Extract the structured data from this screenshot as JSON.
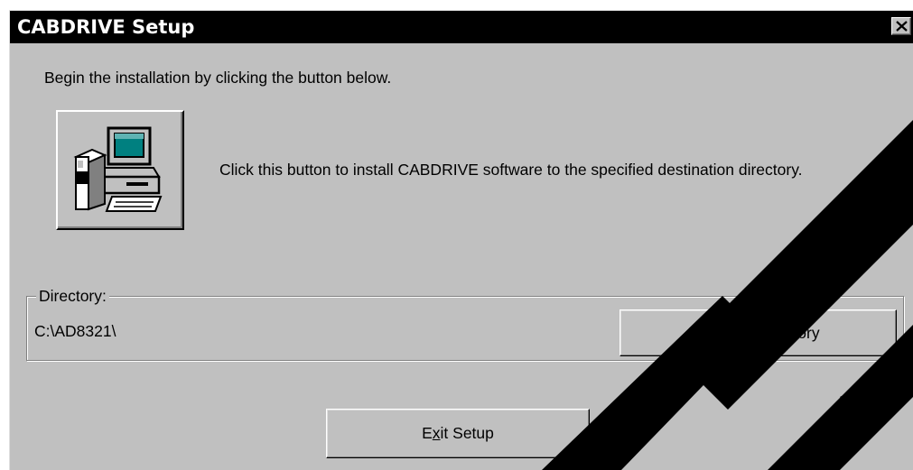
{
  "window": {
    "title": "CABDRIVE Setup"
  },
  "intro_text": "Begin the installation by clicking the button below.",
  "install": {
    "icon": "computer-setup-icon",
    "description": "Click this button to install CABDRIVE software to the specified destination directory."
  },
  "directory": {
    "legend": "Directory:",
    "value": "C:\\AD8321\\",
    "change_button": {
      "before": "",
      "mnemonic": "C",
      "after": "hange Directory"
    }
  },
  "exit_button": {
    "before": "E",
    "mnemonic": "x",
    "after": "it Setup"
  },
  "watermark": {
    "text": "TE",
    "color": "#000000"
  }
}
